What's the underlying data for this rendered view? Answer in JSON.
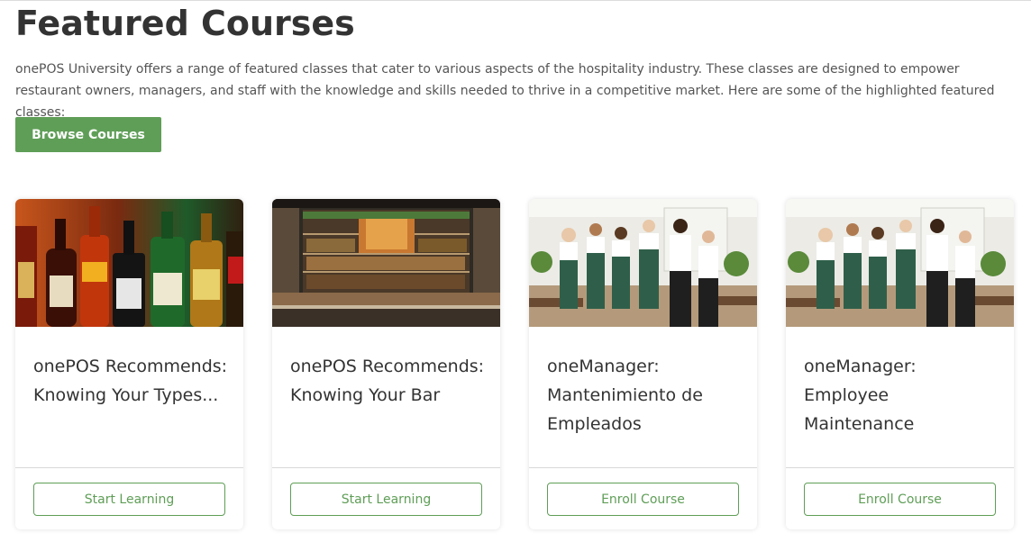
{
  "header": {
    "title": "Featured Courses",
    "intro": "onePOS University offers a range of featured classes that cater to various aspects of the hospitality industry. These classes are designed to empower restaurant owners, managers, and staff with the knowledge and skills needed to thrive in a competitive market. Here are some of the highlighted featured classes:",
    "browse_label": "Browse Courses"
  },
  "colors": {
    "accent": "#5f9e57",
    "title": "#333333",
    "body_text": "#555555"
  },
  "courses": [
    {
      "title": "onePOS Recommends: Knowing Your Types...",
      "button": "Start Learning",
      "image": "liquor-bottles-photo"
    },
    {
      "title": "onePOS Recommends: Knowing Your Bar",
      "button": "Start Learning",
      "image": "bar-interior-photo"
    },
    {
      "title": "oneManager: Mantenimiento de Empleados",
      "button": "Enroll Course",
      "image": "restaurant-staff-photo"
    },
    {
      "title": "oneManager: Employee Maintenance",
      "button": "Enroll Course",
      "image": "restaurant-staff-photo"
    }
  ]
}
